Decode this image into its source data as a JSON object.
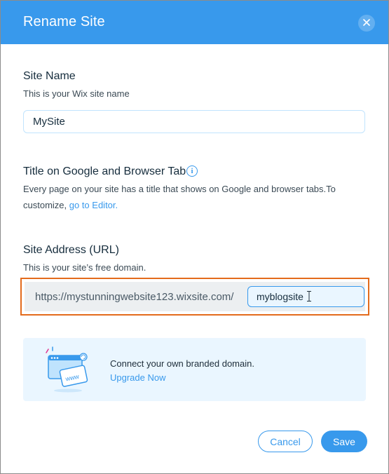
{
  "dialog": {
    "title": "Rename Site",
    "close_icon": "close-icon"
  },
  "site_name": {
    "label": "Site Name",
    "description": "This is your Wix site name",
    "value": "MySite"
  },
  "seo_title": {
    "label": "Title on Google and Browser Tab",
    "info_icon": "info-icon",
    "description_pre": "Every page on your site has a title that shows on Google and browser tabs.To",
    "description_post": "customize, ",
    "link_text": "go to Editor."
  },
  "site_address": {
    "label": "Site Address (URL)",
    "description": "This is your site’s free domain.",
    "prefix": "https://mystunningwebsite123.wixsite.com/",
    "slug": "myblogsite",
    "highlight_color": "#e36b1c"
  },
  "promo": {
    "illustration_icon": "www-browser-icon",
    "text": "Connect your own branded domain.",
    "link_text": "Upgrade Now"
  },
  "footer": {
    "cancel_label": "Cancel",
    "save_label": "Save"
  },
  "colors": {
    "accent": "#3899ec",
    "header": "#3899ec",
    "promo_bg": "#eaf6ff"
  }
}
